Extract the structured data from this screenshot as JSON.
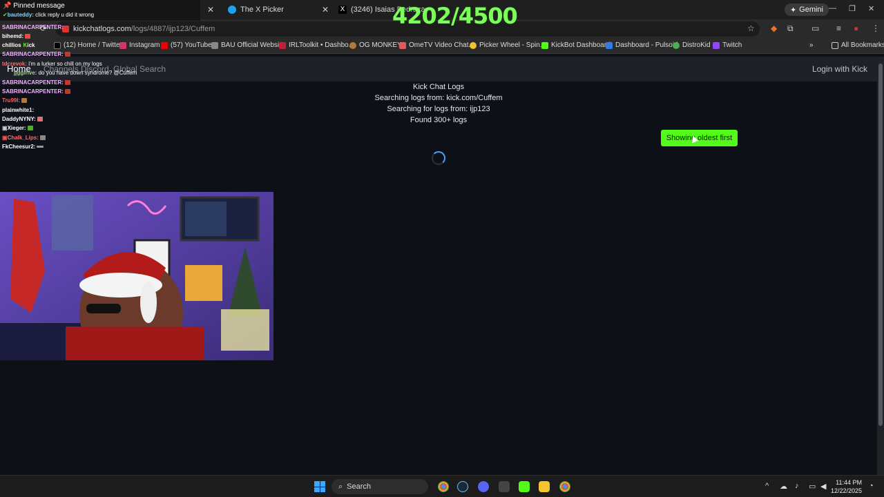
{
  "browser": {
    "tabs": [
      {
        "label": "The X Picker"
      },
      {
        "label": "(3246) Isaias Pedraza"
      }
    ],
    "gemini_label": "Gemini",
    "url_host": "kickchatlogs.com",
    "url_path": "/logs/4887/ijp123/Cuffem",
    "bookmarks": [
      "(12) Home / Twitter",
      "Instagram",
      "(57) YouTube",
      "BAU Official Website",
      "IRLToolkit • Dashbo...",
      "OG MONKEY",
      "OmeTV Video Chat...",
      "Picker Wheel - Spin...",
      "KickBot Dashboard",
      "Dashboard - Pulsoid",
      "DistroKid",
      "Twitch"
    ],
    "all_bookmarks": "All Bookmarks"
  },
  "site": {
    "nav": {
      "home": "Home",
      "channels": "Channels",
      "discord": "Discord",
      "global_search": "Global Search",
      "login": "Login with Kick"
    },
    "main": {
      "title": "Kick Chat Logs",
      "searching_channel": "Searching logs from: kick.com/Cuffem",
      "searching_user": "Searching for logs from: ijp123",
      "found": "Found 300+ logs",
      "sort_button": "Showing oldest first"
    }
  },
  "overlay": {
    "counter": "4202/4500",
    "pinned_title": "Pinned message",
    "pinned_user": "bauteddy:",
    "pinned_text": "click reply u did it wrong",
    "chat": [
      {
        "user": "SABRINACARPENTER:",
        "msg": ""
      },
      {
        "user": "bihemd:",
        "msg": ""
      },
      {
        "user": "SABRINACARPENTER:",
        "msg": ""
      },
      {
        "user": "SABRINACARPENTER:",
        "msg": ""
      },
      {
        "user": "tdcrevok:",
        "msg": "i'm a lurker so chill on my logs"
      },
      {
        "user": "jjggirlve:",
        "msg": "do you have down syndrome? @Cuffem"
      },
      {
        "user": "SABRINACARPENTER:",
        "msg": ""
      },
      {
        "user": "SABRINACARPENTER:",
        "msg": ""
      },
      {
        "user": "Tru99l:",
        "msg": ""
      },
      {
        "user": "plainwhite1:",
        "msg": ""
      },
      {
        "user": "DaddyNYNY:",
        "msg": ""
      },
      {
        "user": "Xieger:",
        "msg": ""
      },
      {
        "user": "Chalk_Lips:",
        "msg": ""
      },
      {
        "user": "FkCheesur2:",
        "msg": ""
      }
    ],
    "chat_partial": [
      "chillios",
      "ick"
    ]
  },
  "taskbar": {
    "search": "Search",
    "time": "11:44 PM",
    "date": "12/22/2025"
  },
  "colors": {
    "kick_green": "#53fc18",
    "counter_green": "#7cff5b",
    "page_bg": "#0d1117"
  }
}
